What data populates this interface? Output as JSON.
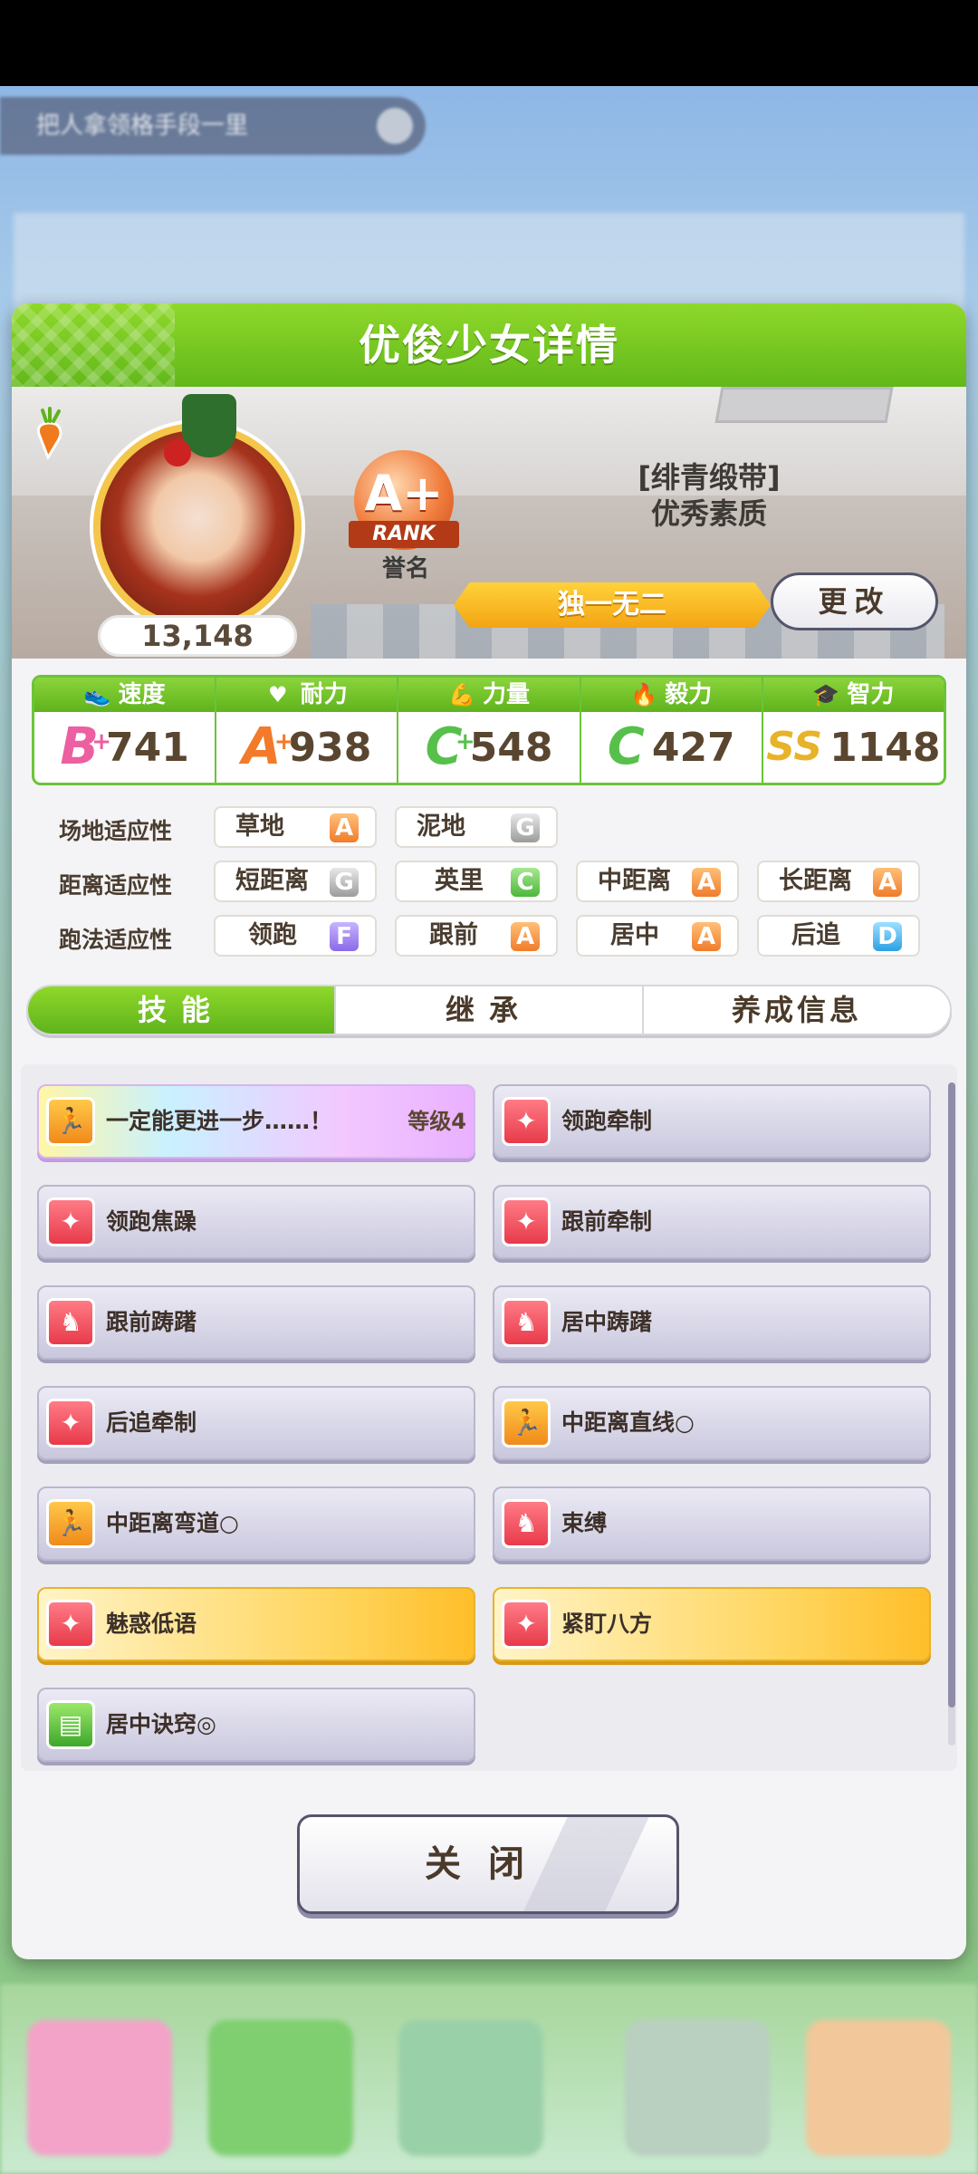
{
  "background": {
    "banner_text": "把人拿领格手段一里"
  },
  "modal": {
    "title": "优俊少女详情",
    "fan_count": "13,148",
    "rank": {
      "grade": "A+",
      "ribbon": "RANK",
      "label": "誉名"
    },
    "title_name": "[绯青缎带]",
    "title_desc": "优秀素质",
    "epithet": "独一无二",
    "change_label": "更改"
  },
  "stats": [
    {
      "name": "速度",
      "icon": "shoe-icon",
      "grade": "B",
      "plus": "+",
      "value": "741",
      "grade_class": "grade-b"
    },
    {
      "name": "耐力",
      "icon": "heart-icon",
      "grade": "A",
      "plus": "+",
      "value": "938",
      "grade_class": "grade-a"
    },
    {
      "name": "力量",
      "icon": "muscle-icon",
      "grade": "C",
      "plus": "+",
      "value": "548",
      "grade_class": "grade-c"
    },
    {
      "name": "毅力",
      "icon": "flame-icon",
      "grade": "C",
      "plus": "",
      "value": "427",
      "grade_class": "grade-c"
    },
    {
      "name": "智力",
      "icon": "graduation-cap-icon",
      "grade": "SS",
      "plus": "",
      "value": "1148",
      "grade_class": "grade-ss"
    }
  ],
  "aptitude": {
    "track": {
      "label": "场地适应性",
      "items": [
        {
          "name": "草地",
          "grade": "A"
        },
        {
          "name": "泥地",
          "grade": "G"
        }
      ]
    },
    "distance": {
      "label": "距离适应性",
      "items": [
        {
          "name": "短距离",
          "grade": "G"
        },
        {
          "name": "英里",
          "grade": "C"
        },
        {
          "name": "中距离",
          "grade": "A"
        },
        {
          "name": "长距离",
          "grade": "A"
        }
      ]
    },
    "style": {
      "label": "跑法适应性",
      "items": [
        {
          "name": "领跑",
          "grade": "F"
        },
        {
          "name": "跟前",
          "grade": "A"
        },
        {
          "name": "居中",
          "grade": "A"
        },
        {
          "name": "后追",
          "grade": "D"
        }
      ]
    }
  },
  "tabs": [
    "技能",
    "继承",
    "养成信息"
  ],
  "skills": [
    {
      "name": "一定能更进一步……！",
      "level": "等级4",
      "style": "rainbow",
      "icon": "runner-icon",
      "icon_color": "ic-orange"
    },
    {
      "name": "领跑牵制",
      "level": "",
      "style": "normal",
      "icon": "sparkle-icon",
      "icon_color": "ic-red"
    },
    {
      "name": "领跑焦躁",
      "level": "",
      "style": "normal",
      "icon": "sparkle-icon",
      "icon_color": "ic-red"
    },
    {
      "name": "跟前牵制",
      "level": "",
      "style": "normal",
      "icon": "sparkle-icon",
      "icon_color": "ic-red"
    },
    {
      "name": "跟前踌躇",
      "level": "",
      "style": "normal",
      "icon": "horse-icon",
      "icon_color": "ic-red"
    },
    {
      "name": "居中踌躇",
      "level": "",
      "style": "normal",
      "icon": "horse-icon",
      "icon_color": "ic-red"
    },
    {
      "name": "后追牵制",
      "level": "",
      "style": "normal",
      "icon": "sparkle-icon",
      "icon_color": "ic-red"
    },
    {
      "name": "中距离直线○",
      "level": "",
      "style": "normal",
      "icon": "runner-icon",
      "icon_color": "ic-orange"
    },
    {
      "name": "中距离弯道○",
      "level": "",
      "style": "normal",
      "icon": "runner-icon",
      "icon_color": "ic-orange"
    },
    {
      "name": "束缚",
      "level": "",
      "style": "normal",
      "icon": "horse-icon",
      "icon_color": "ic-red"
    },
    {
      "name": "魅惑低语",
      "level": "",
      "style": "gold",
      "icon": "sparkle-icon",
      "icon_color": "ic-red"
    },
    {
      "name": "紧盯八方",
      "level": "",
      "style": "gold",
      "icon": "sparkle-icon",
      "icon_color": "ic-red"
    },
    {
      "name": "居中诀窍◎",
      "level": "",
      "style": "normal",
      "icon": "book-icon",
      "icon_color": "ic-green"
    }
  ],
  "close_label": "关闭"
}
